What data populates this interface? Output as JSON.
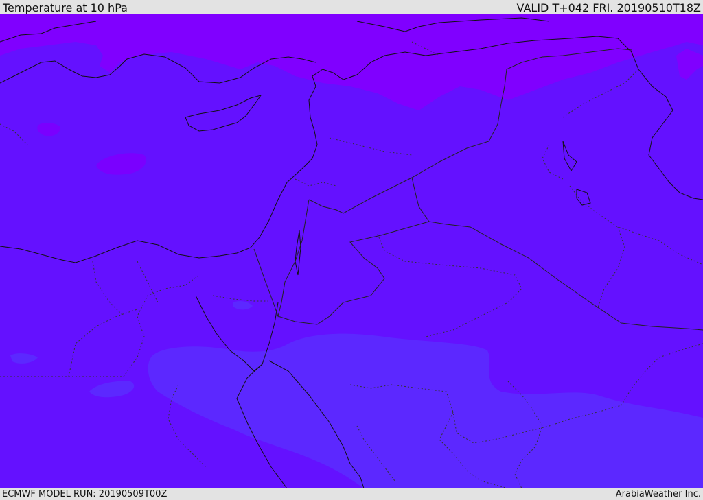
{
  "header": {
    "title": "Temperature at 10 hPa",
    "valid": "VALID T+042 FRI. 20190510T18Z"
  },
  "footer": {
    "model_run": "ECMWF MODEL RUN: 20190509T00Z",
    "credit": "ArabiaWeather Inc."
  },
  "map": {
    "field": "temperature",
    "level": "10 hPa",
    "colors": {
      "cold_band": "#8000ff",
      "mid_band": "#6411ff",
      "warm_band": "#5c28ff",
      "patch": "#7a00ff",
      "coast": "#111111",
      "border": "#222222"
    }
  }
}
